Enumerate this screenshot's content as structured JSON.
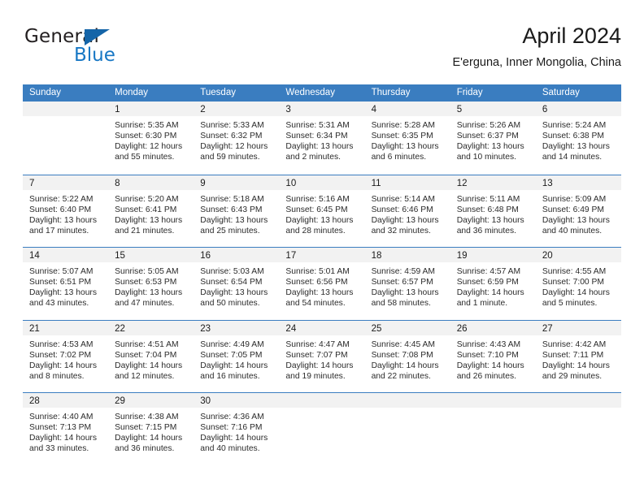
{
  "brand": {
    "name_top": "General",
    "name_bottom": "Blue",
    "accent_color": "#1777c4",
    "triangle_color": "#1565a8"
  },
  "header": {
    "title": "April 2024",
    "subtitle": "E'erguna, Inner Mongolia, China"
  },
  "theme": {
    "header_bar_color": "#3a7dc0",
    "day_band_color": "#f2f2f2",
    "text_color": "#2b2b2b"
  },
  "weekdays": [
    "Sunday",
    "Monday",
    "Tuesday",
    "Wednesday",
    "Thursday",
    "Friday",
    "Saturday"
  ],
  "labels": {
    "sunrise_prefix": "Sunrise:",
    "sunset_prefix": "Sunset:",
    "daylight_prefix": "Daylight:"
  },
  "weeks": [
    [
      {
        "day": "",
        "sunrise": "",
        "sunset": "",
        "daylight_line1": "",
        "daylight_line2": ""
      },
      {
        "day": "1",
        "sunrise": "Sunrise: 5:35 AM",
        "sunset": "Sunset: 6:30 PM",
        "daylight_line1": "Daylight: 12 hours",
        "daylight_line2": "and 55 minutes."
      },
      {
        "day": "2",
        "sunrise": "Sunrise: 5:33 AM",
        "sunset": "Sunset: 6:32 PM",
        "daylight_line1": "Daylight: 12 hours",
        "daylight_line2": "and 59 minutes."
      },
      {
        "day": "3",
        "sunrise": "Sunrise: 5:31 AM",
        "sunset": "Sunset: 6:34 PM",
        "daylight_line1": "Daylight: 13 hours",
        "daylight_line2": "and 2 minutes."
      },
      {
        "day": "4",
        "sunrise": "Sunrise: 5:28 AM",
        "sunset": "Sunset: 6:35 PM",
        "daylight_line1": "Daylight: 13 hours",
        "daylight_line2": "and 6 minutes."
      },
      {
        "day": "5",
        "sunrise": "Sunrise: 5:26 AM",
        "sunset": "Sunset: 6:37 PM",
        "daylight_line1": "Daylight: 13 hours",
        "daylight_line2": "and 10 minutes."
      },
      {
        "day": "6",
        "sunrise": "Sunrise: 5:24 AM",
        "sunset": "Sunset: 6:38 PM",
        "daylight_line1": "Daylight: 13 hours",
        "daylight_line2": "and 14 minutes."
      }
    ],
    [
      {
        "day": "7",
        "sunrise": "Sunrise: 5:22 AM",
        "sunset": "Sunset: 6:40 PM",
        "daylight_line1": "Daylight: 13 hours",
        "daylight_line2": "and 17 minutes."
      },
      {
        "day": "8",
        "sunrise": "Sunrise: 5:20 AM",
        "sunset": "Sunset: 6:41 PM",
        "daylight_line1": "Daylight: 13 hours",
        "daylight_line2": "and 21 minutes."
      },
      {
        "day": "9",
        "sunrise": "Sunrise: 5:18 AM",
        "sunset": "Sunset: 6:43 PM",
        "daylight_line1": "Daylight: 13 hours",
        "daylight_line2": "and 25 minutes."
      },
      {
        "day": "10",
        "sunrise": "Sunrise: 5:16 AM",
        "sunset": "Sunset: 6:45 PM",
        "daylight_line1": "Daylight: 13 hours",
        "daylight_line2": "and 28 minutes."
      },
      {
        "day": "11",
        "sunrise": "Sunrise: 5:14 AM",
        "sunset": "Sunset: 6:46 PM",
        "daylight_line1": "Daylight: 13 hours",
        "daylight_line2": "and 32 minutes."
      },
      {
        "day": "12",
        "sunrise": "Sunrise: 5:11 AM",
        "sunset": "Sunset: 6:48 PM",
        "daylight_line1": "Daylight: 13 hours",
        "daylight_line2": "and 36 minutes."
      },
      {
        "day": "13",
        "sunrise": "Sunrise: 5:09 AM",
        "sunset": "Sunset: 6:49 PM",
        "daylight_line1": "Daylight: 13 hours",
        "daylight_line2": "and 40 minutes."
      }
    ],
    [
      {
        "day": "14",
        "sunrise": "Sunrise: 5:07 AM",
        "sunset": "Sunset: 6:51 PM",
        "daylight_line1": "Daylight: 13 hours",
        "daylight_line2": "and 43 minutes."
      },
      {
        "day": "15",
        "sunrise": "Sunrise: 5:05 AM",
        "sunset": "Sunset: 6:53 PM",
        "daylight_line1": "Daylight: 13 hours",
        "daylight_line2": "and 47 minutes."
      },
      {
        "day": "16",
        "sunrise": "Sunrise: 5:03 AM",
        "sunset": "Sunset: 6:54 PM",
        "daylight_line1": "Daylight: 13 hours",
        "daylight_line2": "and 50 minutes."
      },
      {
        "day": "17",
        "sunrise": "Sunrise: 5:01 AM",
        "sunset": "Sunset: 6:56 PM",
        "daylight_line1": "Daylight: 13 hours",
        "daylight_line2": "and 54 minutes."
      },
      {
        "day": "18",
        "sunrise": "Sunrise: 4:59 AM",
        "sunset": "Sunset: 6:57 PM",
        "daylight_line1": "Daylight: 13 hours",
        "daylight_line2": "and 58 minutes."
      },
      {
        "day": "19",
        "sunrise": "Sunrise: 4:57 AM",
        "sunset": "Sunset: 6:59 PM",
        "daylight_line1": "Daylight: 14 hours",
        "daylight_line2": "and 1 minute."
      },
      {
        "day": "20",
        "sunrise": "Sunrise: 4:55 AM",
        "sunset": "Sunset: 7:00 PM",
        "daylight_line1": "Daylight: 14 hours",
        "daylight_line2": "and 5 minutes."
      }
    ],
    [
      {
        "day": "21",
        "sunrise": "Sunrise: 4:53 AM",
        "sunset": "Sunset: 7:02 PM",
        "daylight_line1": "Daylight: 14 hours",
        "daylight_line2": "and 8 minutes."
      },
      {
        "day": "22",
        "sunrise": "Sunrise: 4:51 AM",
        "sunset": "Sunset: 7:04 PM",
        "daylight_line1": "Daylight: 14 hours",
        "daylight_line2": "and 12 minutes."
      },
      {
        "day": "23",
        "sunrise": "Sunrise: 4:49 AM",
        "sunset": "Sunset: 7:05 PM",
        "daylight_line1": "Daylight: 14 hours",
        "daylight_line2": "and 16 minutes."
      },
      {
        "day": "24",
        "sunrise": "Sunrise: 4:47 AM",
        "sunset": "Sunset: 7:07 PM",
        "daylight_line1": "Daylight: 14 hours",
        "daylight_line2": "and 19 minutes."
      },
      {
        "day": "25",
        "sunrise": "Sunrise: 4:45 AM",
        "sunset": "Sunset: 7:08 PM",
        "daylight_line1": "Daylight: 14 hours",
        "daylight_line2": "and 22 minutes."
      },
      {
        "day": "26",
        "sunrise": "Sunrise: 4:43 AM",
        "sunset": "Sunset: 7:10 PM",
        "daylight_line1": "Daylight: 14 hours",
        "daylight_line2": "and 26 minutes."
      },
      {
        "day": "27",
        "sunrise": "Sunrise: 4:42 AM",
        "sunset": "Sunset: 7:11 PM",
        "daylight_line1": "Daylight: 14 hours",
        "daylight_line2": "and 29 minutes."
      }
    ],
    [
      {
        "day": "28",
        "sunrise": "Sunrise: 4:40 AM",
        "sunset": "Sunset: 7:13 PM",
        "daylight_line1": "Daylight: 14 hours",
        "daylight_line2": "and 33 minutes."
      },
      {
        "day": "29",
        "sunrise": "Sunrise: 4:38 AM",
        "sunset": "Sunset: 7:15 PM",
        "daylight_line1": "Daylight: 14 hours",
        "daylight_line2": "and 36 minutes."
      },
      {
        "day": "30",
        "sunrise": "Sunrise: 4:36 AM",
        "sunset": "Sunset: 7:16 PM",
        "daylight_line1": "Daylight: 14 hours",
        "daylight_line2": "and 40 minutes."
      },
      {
        "day": "",
        "sunrise": "",
        "sunset": "",
        "daylight_line1": "",
        "daylight_line2": ""
      },
      {
        "day": "",
        "sunrise": "",
        "sunset": "",
        "daylight_line1": "",
        "daylight_line2": ""
      },
      {
        "day": "",
        "sunrise": "",
        "sunset": "",
        "daylight_line1": "",
        "daylight_line2": ""
      },
      {
        "day": "",
        "sunrise": "",
        "sunset": "",
        "daylight_line1": "",
        "daylight_line2": ""
      }
    ]
  ]
}
